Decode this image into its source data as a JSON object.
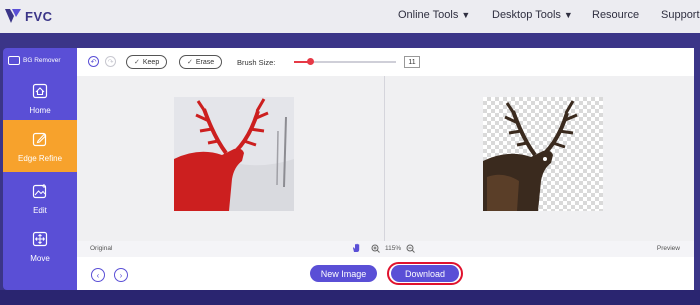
{
  "header": {
    "logo_text": "FVC",
    "nav": [
      {
        "label": "Online Tools",
        "has_dropdown": true
      },
      {
        "label": "Desktop Tools",
        "has_dropdown": true
      },
      {
        "label": "Resource",
        "has_dropdown": false
      },
      {
        "label": "Support",
        "has_dropdown": false
      }
    ]
  },
  "sidebar": {
    "title": "BG Remover",
    "items": [
      {
        "label": "Home",
        "icon": "home-icon",
        "active": false
      },
      {
        "label": "Edge Refine",
        "icon": "edge-refine-icon",
        "active": true
      },
      {
        "label": "Edit",
        "icon": "edit-image-icon",
        "active": false
      },
      {
        "label": "Move",
        "icon": "move-icon",
        "active": false
      }
    ]
  },
  "toolbar": {
    "keep_label": "Keep",
    "erase_label": "Erase",
    "brush_size_label": "Brush Size:",
    "brush_size_value": "11",
    "brush_slider_fraction": 0.16
  },
  "status": {
    "original_label": "Original",
    "zoom_value": "115%",
    "preview_label": "Preview"
  },
  "footer": {
    "new_image_label": "New Image",
    "download_label": "Download"
  },
  "colors": {
    "brand_purple": "#5a4fd6",
    "header_band": "#3b3588",
    "active_orange": "#f7a22c",
    "highlight_red": "#e0122d",
    "mask_red": "#cc1f1f"
  }
}
